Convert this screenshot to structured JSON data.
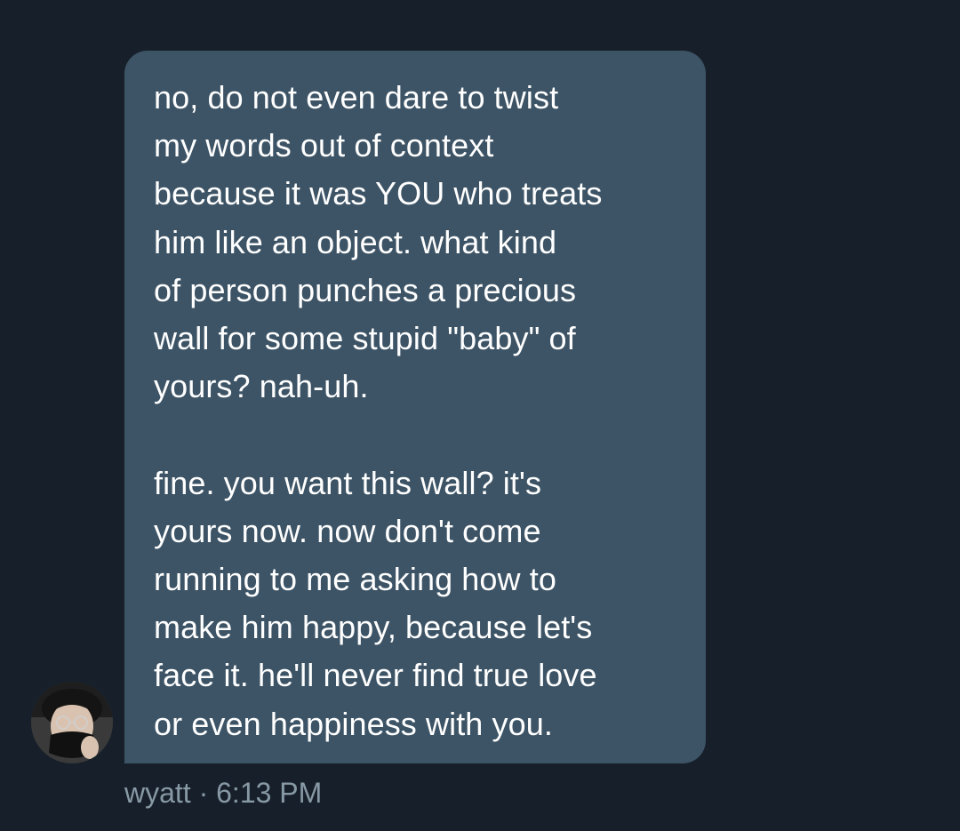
{
  "message": {
    "paragraph_1": [
      "no, do not even dare to twist",
      "my words out of context",
      "because it was YOU who treats",
      "him like an object. what kind",
      "of person punches a precious",
      "wall for some stupid \"baby\" of",
      "yours? nah-uh."
    ],
    "paragraph_2": [
      "fine. you want this wall? it's",
      "yours now. now don't come",
      "running to me asking how to",
      "make him happy, because let's",
      "face it. he'll never find true love",
      "or even happiness with you."
    ]
  },
  "sender": {
    "name": "wyatt",
    "separator": " · ",
    "time": "6:13 PM",
    "avatar_icon": "user-avatar-photo"
  },
  "colors": {
    "background": "#17202a",
    "bubble": "#3d5466",
    "text": "#ffffff",
    "meta": "#8899a6"
  }
}
